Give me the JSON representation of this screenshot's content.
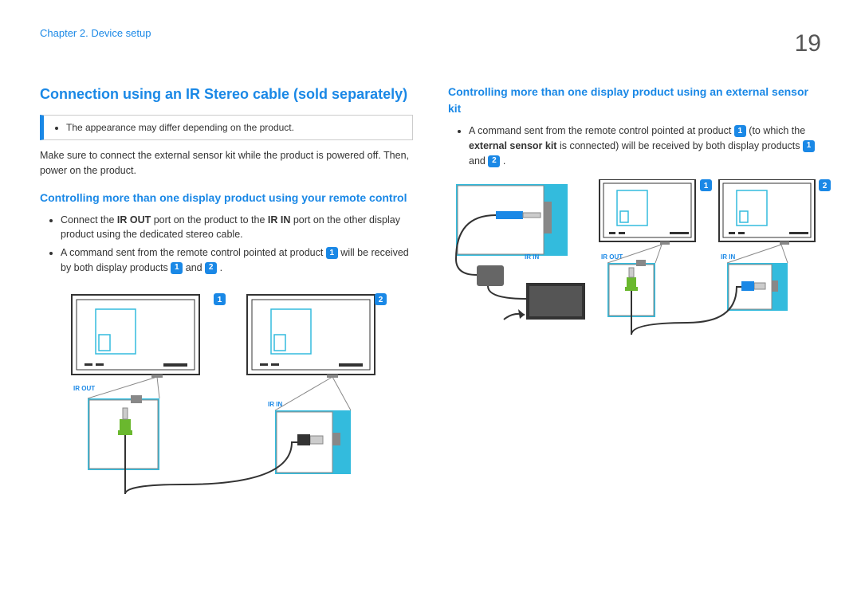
{
  "header": {
    "chapter": "Chapter 2. Device setup",
    "page_number": "19"
  },
  "left": {
    "title": "Connection using an IR Stereo cable (sold separately)",
    "note": "The appearance may differ depending on the product.",
    "intro": "Make sure to connect the external sensor kit while the product is powered off. Then, power on the product.",
    "sub_title": "Controlling more than one display product using your remote control",
    "bullet1_a": "Connect the ",
    "bullet1_b": "IR OUT",
    "bullet1_c": " port on the product to the ",
    "bullet1_d": "IR IN",
    "bullet1_e": " port on the other display product using the dedicated stereo cable.",
    "bullet2_a": "A command sent from the remote control pointed at product ",
    "bullet2_b": " will be received by both display products ",
    "bullet2_c": " and ",
    "bullet2_d": " .",
    "badge1": "1",
    "badge2": "2"
  },
  "right": {
    "sub_title": "Controlling more than one display product using an external sensor kit",
    "bullet1_a": "A command sent from the remote control pointed at product ",
    "bullet1_b": " (to which the ",
    "bullet1_c": "external sensor kit",
    "bullet1_d": " is connected) will be received by both display products ",
    "bullet1_e": " and ",
    "bullet1_f": " .",
    "badge1": "1",
    "badge2": "2"
  },
  "diagram_labels": {
    "ir_out": "IR OUT",
    "ir_in": "IR IN",
    "badge1": "1",
    "badge2": "2"
  }
}
